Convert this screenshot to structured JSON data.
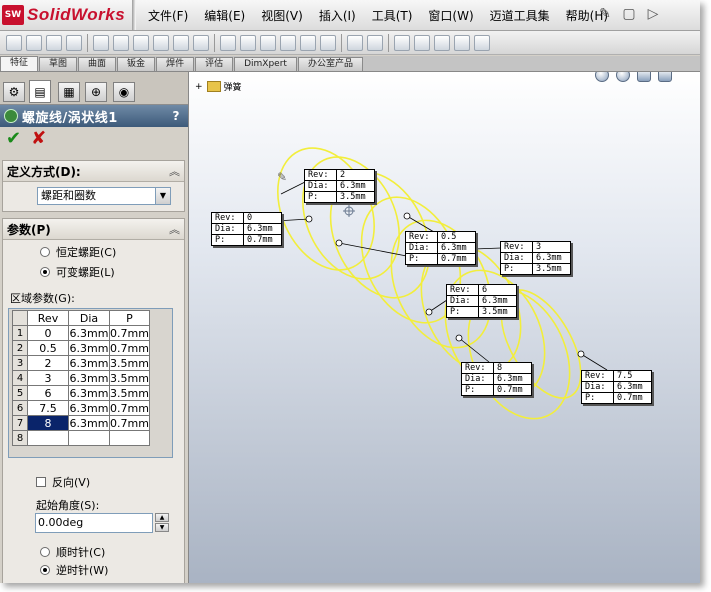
{
  "app": {
    "name": "SolidWorks",
    "logo_mark": "SW"
  },
  "menu": [
    "文件(F)",
    "编辑(E)",
    "视图(V)",
    "插入(I)",
    "工具(T)",
    "窗口(W)",
    "迈道工具集",
    "帮助(H)"
  ],
  "command_tabs": [
    "特征",
    "草图",
    "曲面",
    "钣金",
    "焊件",
    "评估",
    "DimXpert",
    "办公室产品"
  ],
  "property_manager": {
    "title": "螺旋线/涡状线1",
    "help_label": "?",
    "ok_symbol": "✔",
    "cancel_symbol": "✘",
    "definition": {
      "header": "定义方式(D):",
      "selected": "螺距和圈数"
    },
    "parameters": {
      "header": "参数(P)",
      "constant_pitch": "恒定螺距(C)",
      "variable_pitch": "可变螺距(L)",
      "region_label": "区域参数(G):",
      "columns": [
        "Rev",
        "Dia",
        "P"
      ],
      "rows": [
        [
          "1",
          "0",
          "6.3mm",
          "0.7mm"
        ],
        [
          "2",
          "0.5",
          "6.3mm",
          "0.7mm"
        ],
        [
          "3",
          "2",
          "6.3mm",
          "3.5mm"
        ],
        [
          "4",
          "3",
          "6.3mm",
          "3.5mm"
        ],
        [
          "5",
          "6",
          "6.3mm",
          "3.5mm"
        ],
        [
          "6",
          "7.5",
          "6.3mm",
          "0.7mm"
        ],
        [
          "7",
          "8",
          "6.3mm",
          "0.7mm"
        ],
        [
          "8",
          "",
          "",
          ""
        ]
      ],
      "reverse": "反向(V)",
      "start_angle_label": "起始角度(S):",
      "start_angle_value": "0.00deg",
      "clockwise": "顺时针(C)",
      "counterclockwise": "逆时针(W)"
    }
  },
  "tree_root": "弹簧",
  "callouts": [
    {
      "rev": "2",
      "dia": "6.3mm",
      "p": "3.5mm"
    },
    {
      "rev": "0",
      "dia": "6.3mm",
      "p": "0.7mm"
    },
    {
      "rev": "0.5",
      "dia": "6.3mm",
      "p": "0.7mm"
    },
    {
      "rev": "3",
      "dia": "6.3mm",
      "p": "3.5mm"
    },
    {
      "rev": "6",
      "dia": "6.3mm",
      "p": "3.5mm"
    },
    {
      "rev": "8",
      "dia": "6.3mm",
      "p": "0.7mm"
    },
    {
      "rev": "7.5",
      "dia": "6.3mm",
      "p": "0.7mm"
    }
  ],
  "callout_keys": {
    "rev": "Rev:",
    "dia": "Dia:",
    "p": "P:"
  },
  "colors": {
    "helix": "#f2ee3c",
    "header": "#3d5a7a",
    "brand": "#c8102e"
  }
}
